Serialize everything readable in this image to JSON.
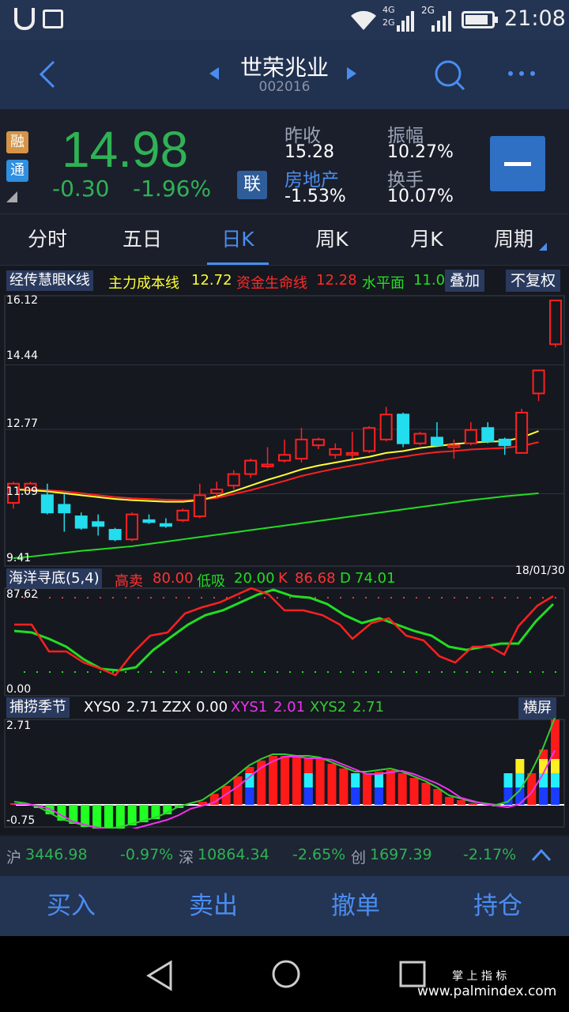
{
  "status": {
    "time": "21:08",
    "net1": "4G",
    "net2": "2G",
    "net3": "2G"
  },
  "header": {
    "name": "世荣兆业",
    "code": "002016"
  },
  "quote": {
    "badge_rong": "融",
    "badge_tong": "通",
    "price": "14.98",
    "change": "-0.30",
    "change_pct": "-1.96%",
    "lian": "联",
    "prev_close_label": "昨收",
    "prev_close": "15.28",
    "amplitude_label": "振幅",
    "amplitude": "10.27%",
    "sector_label": "房地产",
    "sector_change": "-1.53%",
    "turnover_label": "换手",
    "turnover": "10.07%"
  },
  "tabs": [
    "分时",
    "五日",
    "日K",
    "周K",
    "月K",
    "周期"
  ],
  "main_panel": {
    "title": "经传慧眼K线",
    "legend": [
      {
        "name": "主力成本线",
        "value": "12.72",
        "color": "#ffff33"
      },
      {
        "name": "资金生命线",
        "value": "12.28",
        "color": "#ff2a2a"
      },
      {
        "name": "水平面",
        "value": "11.0",
        "color": "#22dd22"
      }
    ],
    "btn_overlay": "叠加",
    "btn_fq": "不复权",
    "y_labels": [
      "16.12",
      "14.44",
      "12.77",
      "11.09",
      "9.41"
    ],
    "date": "18/01/30"
  },
  "kdj_panel": {
    "title": "海洋寻底(5,4)",
    "items": [
      {
        "name": "高卖",
        "value": "80.00",
        "color": "#ff3333"
      },
      {
        "name": "低吸",
        "value": "20.00",
        "color": "#22dd22"
      },
      {
        "name": "K",
        "value": "86.68",
        "color": "#ff3333"
      },
      {
        "name": "D",
        "value": "74.01",
        "color": "#22dd22"
      }
    ],
    "y_top": "87.62",
    "y_bottom": "0.00"
  },
  "season_panel": {
    "title": "捕捞季节",
    "items": [
      {
        "name": "XYS0",
        "value": "2.71",
        "color": "#ffffff"
      },
      {
        "name": "ZZX",
        "value": "0.00",
        "color": "#ffffff"
      },
      {
        "name": "XYS1",
        "value": "2.01",
        "color": "#ee33ee"
      },
      {
        "name": "XYS2",
        "value": "2.71",
        "color": "#33cc33"
      }
    ],
    "btn_landscape": "横屏",
    "y_top": "2.71",
    "y_bottom": "-0.75"
  },
  "indices": [
    {
      "name": "沪",
      "value": "3446.98",
      "change": "-0.97%"
    },
    {
      "name": "深",
      "value": "10864.34",
      "change": "-2.65%"
    },
    {
      "name": "创",
      "value": "1697.39",
      "change": "-2.17%"
    }
  ],
  "trade": {
    "buy": "买入",
    "sell": "卖出",
    "cancel": "撤单",
    "position": "持仓"
  },
  "watermark": {
    "line1": "掌 上 指 标",
    "line2": "www.palmindex.com"
  },
  "colors": {
    "up": "#ff2020",
    "down": "#22ddee",
    "green_price": "#2fb255",
    "accent": "#2f6fc4"
  },
  "chart_data": {
    "type": "candlestick",
    "ylim": [
      9.41,
      16.12
    ],
    "candles": [
      {
        "o": 10.85,
        "c": 11.35,
        "h": 11.4,
        "l": 10.7
      },
      {
        "o": 11.2,
        "c": 11.35,
        "h": 11.4,
        "l": 11.15
      },
      {
        "o": 11.05,
        "c": 10.6,
        "h": 11.35,
        "l": 10.55
      },
      {
        "o": 10.8,
        "c": 10.6,
        "h": 11.1,
        "l": 10.1
      },
      {
        "o": 10.5,
        "c": 10.2,
        "h": 10.6,
        "l": 10.15
      },
      {
        "o": 10.35,
        "c": 10.25,
        "h": 10.55,
        "l": 10.0
      },
      {
        "o": 10.15,
        "c": 9.9,
        "h": 10.2,
        "l": 9.85
      },
      {
        "o": 9.9,
        "c": 10.55,
        "h": 10.6,
        "l": 9.85
      },
      {
        "o": 10.4,
        "c": 10.35,
        "h": 10.55,
        "l": 10.3
      },
      {
        "o": 10.3,
        "c": 10.25,
        "h": 10.45,
        "l": 10.2
      },
      {
        "o": 10.4,
        "c": 10.65,
        "h": 10.7,
        "l": 10.35
      },
      {
        "o": 10.5,
        "c": 11.05,
        "h": 11.35,
        "l": 10.45
      },
      {
        "o": 11.1,
        "c": 11.2,
        "h": 11.4,
        "l": 11.0
      },
      {
        "o": 11.3,
        "c": 11.6,
        "h": 11.7,
        "l": 11.2
      },
      {
        "o": 11.6,
        "c": 11.95,
        "h": 12.0,
        "l": 11.5
      },
      {
        "o": 11.8,
        "c": 11.85,
        "h": 12.3,
        "l": 11.75
      },
      {
        "o": 11.95,
        "c": 12.1,
        "h": 12.5,
        "l": 11.9
      },
      {
        "o": 12.0,
        "c": 12.5,
        "h": 12.8,
        "l": 11.9
      },
      {
        "o": 12.35,
        "c": 12.5,
        "h": 12.55,
        "l": 12.25
      },
      {
        "o": 12.1,
        "c": 12.25,
        "h": 12.4,
        "l": 12.0
      },
      {
        "o": 12.1,
        "c": 12.15,
        "h": 12.7,
        "l": 12.0
      },
      {
        "o": 12.2,
        "c": 12.8,
        "h": 12.85,
        "l": 12.15
      },
      {
        "o": 12.5,
        "c": 13.15,
        "h": 13.35,
        "l": 12.45
      },
      {
        "o": 13.15,
        "c": 12.4,
        "h": 13.2,
        "l": 12.3
      },
      {
        "o": 12.4,
        "c": 12.65,
        "h": 12.7,
        "l": 12.35
      },
      {
        "o": 12.55,
        "c": 12.35,
        "h": 12.95,
        "l": 12.3
      },
      {
        "o": 12.3,
        "c": 12.35,
        "h": 12.5,
        "l": 12.0
      },
      {
        "o": 12.4,
        "c": 12.75,
        "h": 12.95,
        "l": 12.35
      },
      {
        "o": 12.8,
        "c": 12.45,
        "h": 12.95,
        "l": 12.4
      },
      {
        "o": 12.5,
        "c": 12.35,
        "h": 12.55,
        "l": 12.1
      },
      {
        "o": 12.15,
        "c": 13.2,
        "h": 13.3,
        "l": 12.15
      },
      {
        "o": 13.7,
        "c": 14.3,
        "h": 14.3,
        "l": 13.5
      },
      {
        "o": 14.98,
        "c": 16.12,
        "h": 16.12,
        "l": 14.9
      }
    ],
    "ma_yellow": [
      11.2,
      11.18,
      11.15,
      11.1,
      11.05,
      11.0,
      10.95,
      10.92,
      10.9,
      10.88,
      10.88,
      10.92,
      11.02,
      11.15,
      11.3,
      11.45,
      11.58,
      11.72,
      11.82,
      11.9,
      11.98,
      12.05,
      12.15,
      12.2,
      12.28,
      12.33,
      12.38,
      12.42,
      12.44,
      12.46,
      12.55,
      12.72
    ],
    "ma_red": [
      11.2,
      11.2,
      11.18,
      11.15,
      11.1,
      11.05,
      11.0,
      10.97,
      10.95,
      10.93,
      10.92,
      10.93,
      10.98,
      11.08,
      11.18,
      11.3,
      11.42,
      11.55,
      11.65,
      11.74,
      11.82,
      11.9,
      11.98,
      12.05,
      12.12,
      12.17,
      12.2,
      12.24,
      12.26,
      12.28,
      12.33,
      12.43
    ],
    "ma_green": [
      9.41,
      9.45,
      9.5,
      9.55,
      9.6,
      9.64,
      9.68,
      9.72,
      9.78,
      9.84,
      9.9,
      9.96,
      10.02,
      10.08,
      10.14,
      10.2,
      10.26,
      10.32,
      10.38,
      10.44,
      10.5,
      10.56,
      10.62,
      10.68,
      10.74,
      10.8,
      10.86,
      10.92,
      10.97,
      11.02,
      11.06,
      11.1
    ]
  }
}
